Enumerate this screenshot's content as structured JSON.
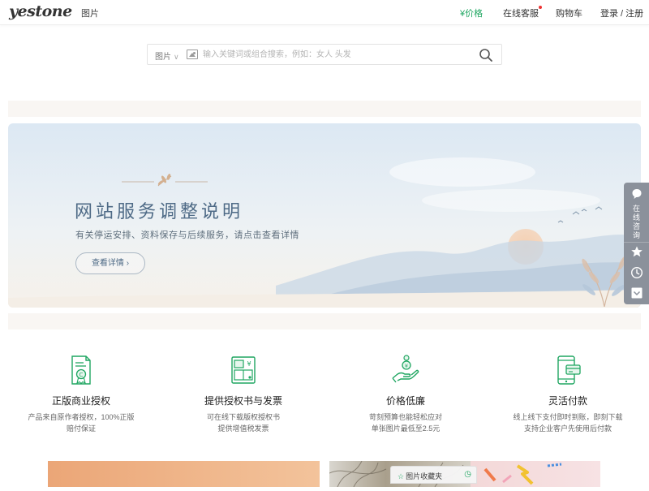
{
  "header": {
    "logo": "yestone",
    "nav_left": "图片",
    "price": "¥价格",
    "service": "在线客服",
    "cart": "购物车",
    "login": "登录 / 注册"
  },
  "search": {
    "category": "图片",
    "placeholder": "输入关键词或组合搜索，例如：女人 头发",
    "value": ""
  },
  "banner": {
    "title": "网站服务调整说明",
    "subtitle": "有关停运安排、资料保存与后续服务，请点击查看详情",
    "button": "查看详情 ›"
  },
  "float_bar": {
    "consult": "在线咨询"
  },
  "features": [
    {
      "icon": "certificate-icon",
      "title": "正版商业授权",
      "line1": "产品来自原作者授权，100%正版",
      "line2": "赔付保证"
    },
    {
      "icon": "license-invoice-icon",
      "title": "提供授权书与发票",
      "line1": "可在线下载版权授权书",
      "line2": "提供增值税发票"
    },
    {
      "icon": "price-hand-icon",
      "title": "价格低廉",
      "line1": "苛刻预算也能轻松应对",
      "line2": "单张图片最低至2.5元"
    },
    {
      "icon": "payment-icon",
      "title": "灵活付款",
      "line1": "线上线下支付即时到账，即刻下载",
      "line2": "支持企业客户先使用后付款"
    }
  ],
  "favorites": {
    "label": "图片收藏夹"
  },
  "colors": {
    "accent_green": "#1fa661",
    "banner_title": "#4e6a86",
    "float_bar": "#8b919b"
  }
}
